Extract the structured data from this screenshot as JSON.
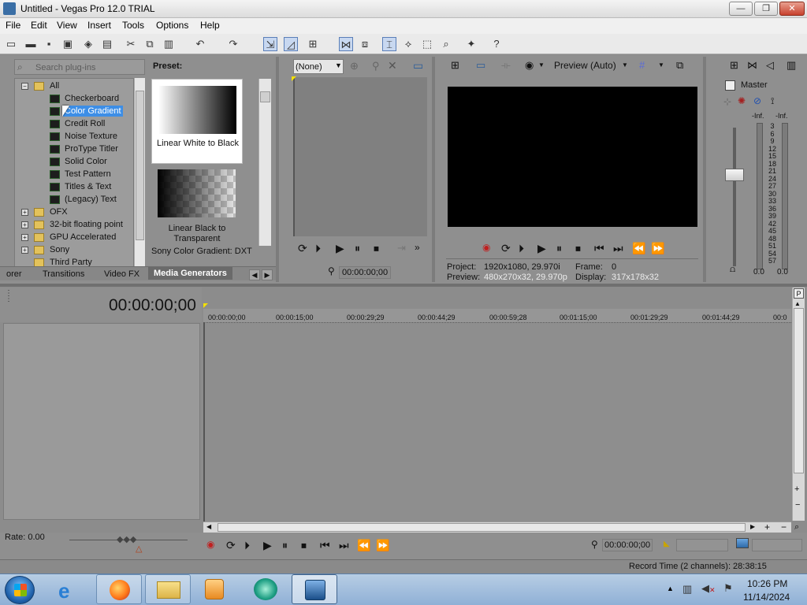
{
  "window": {
    "title": "Untitled - Vegas Pro 12.0 TRIAL",
    "min_glyph": "—",
    "max_glyph": "❐",
    "close_glyph": "✕"
  },
  "menu": [
    "File",
    "Edit",
    "View",
    "Insert",
    "Tools",
    "Options",
    "Help"
  ],
  "plugins": {
    "search_placeholder": "Search plug-ins",
    "tree": [
      {
        "label": "All",
        "type": "folder"
      },
      {
        "label": "Checkerboard",
        "type": "plugin"
      },
      {
        "label": "Color Gradient",
        "type": "plugin",
        "selected": true
      },
      {
        "label": "Credit Roll",
        "type": "plugin"
      },
      {
        "label": "Noise Texture",
        "type": "plugin"
      },
      {
        "label": "ProType Titler",
        "type": "plugin"
      },
      {
        "label": "Solid Color",
        "type": "plugin"
      },
      {
        "label": "Test Pattern",
        "type": "plugin"
      },
      {
        "label": "Titles & Text",
        "type": "plugin"
      },
      {
        "label": "(Legacy) Text",
        "type": "plugin"
      },
      {
        "label": "OFX",
        "type": "folder"
      },
      {
        "label": "32-bit floating point",
        "type": "folder"
      },
      {
        "label": "GPU Accelerated",
        "type": "folder"
      },
      {
        "label": "Sony",
        "type": "folder"
      },
      {
        "label": "Third Party",
        "type": "folder"
      }
    ]
  },
  "preset": {
    "header": "Preset:",
    "items": [
      "Linear White to Black",
      "Linear Black to Transparent"
    ],
    "footer": "Sony Color Gradient: DXT"
  },
  "tabs": [
    "orer",
    "Transitions",
    "Video FX",
    "Media Generators"
  ],
  "trimmer": {
    "dropdown": "(None)",
    "timecode": "00:00:00;00"
  },
  "preview": {
    "mode": "Preview (Auto)",
    "project_label": "Project:",
    "project_value": "1920x1080, 29.970i",
    "preview_label": "Preview:",
    "preview_value": "480x270x32, 29.970p",
    "frame_label": "Frame:",
    "frame_value": "0",
    "display_label": "Display:",
    "display_value": "317x178x32"
  },
  "master": {
    "title": "Master",
    "inf_left": "-Inf.",
    "inf_right": "-Inf.",
    "db_scale": [
      "3",
      "6",
      "9",
      "12",
      "15",
      "18",
      "21",
      "24",
      "27",
      "30",
      "33",
      "36",
      "39",
      "42",
      "45",
      "48",
      "51",
      "54",
      "57"
    ],
    "left_value": "0.0",
    "right_value": "0.0"
  },
  "timeline": {
    "cursor_time": "00:00:00;00",
    "ruler": [
      "00:00:00;00",
      "00:00:15;00",
      "00:00:29;29",
      "00:00:44;29",
      "00:00:59;28",
      "00:01:15;00",
      "00:01:29;29",
      "00:01:44;29",
      "00:0"
    ],
    "rate": "Rate: 0.00",
    "transport_time": "00:00:00;00",
    "record_time": "Record Time (2 channels): 28:38:15"
  },
  "taskbar": {
    "time": "10:26 PM",
    "date": "11/14/2024"
  }
}
